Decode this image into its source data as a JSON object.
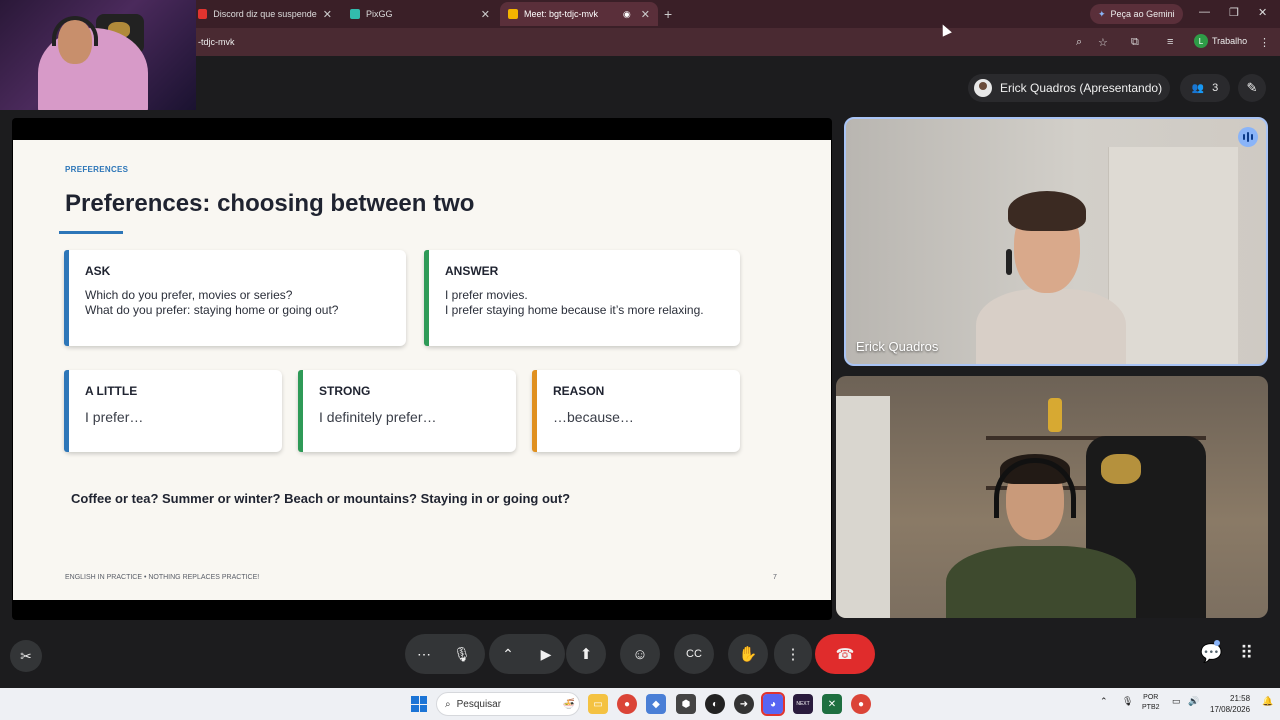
{
  "browser": {
    "tabs": [
      {
        "title": "Discord diz que suspendeu live",
        "favicon_color": "#e0342f"
      },
      {
        "title": "PixGG",
        "favicon_color": "#32bcad"
      },
      {
        "title": "Meet: bgt-tdjc-mvk",
        "favicon_color": "#f4b400",
        "active": true
      }
    ],
    "gemini_label": "Peça ao Gemini",
    "url": "-tdjc-mvk",
    "profile_initial": "L",
    "profile_label": "Trabalho"
  },
  "meet": {
    "presenter_label": "Erick Quadros (Apresentando)",
    "participant_count": "3",
    "tiles": [
      {
        "name": "Erick Quadros",
        "speaking": true
      },
      {
        "name": ""
      }
    ]
  },
  "slide": {
    "kicker": "PREFERENCES",
    "title": "Preferences: choosing between two",
    "accent_color": "#2d76b8",
    "cards": [
      {
        "heading": "ASK",
        "lines": [
          "Which do you prefer, movies or series?",
          "What do you prefer: staying home or going out?"
        ],
        "color": "#2d76b8"
      },
      {
        "heading": "ANSWER",
        "lines": [
          "I prefer movies.",
          "I prefer staying home because it’s more relaxing."
        ],
        "color": "#2e9a57"
      },
      {
        "heading": "A LITTLE",
        "lines": [
          "I prefer…"
        ],
        "color": "#2d76b8"
      },
      {
        "heading": "STRONG",
        "lines": [
          "I definitely prefer…"
        ],
        "color": "#2e9a57"
      },
      {
        "heading": "REASON",
        "lines": [
          "…because…"
        ],
        "color": "#e0901f"
      }
    ],
    "question": "Coffee or tea? Summer or winter? Beach or mountains? Staying in or going out?",
    "footer": "ENGLISH IN PRACTICE  •  NOTHING REPLACES PRACTICE!",
    "page_number": "7"
  },
  "controls": {
    "more_icon": "⋯",
    "end_call_color": "#e02c2c"
  },
  "taskbar": {
    "search_placeholder": "Pesquisar",
    "language_top": "POR",
    "language_bottom": "PTB2",
    "time": "21:58",
    "date": "17/08/2026"
  }
}
